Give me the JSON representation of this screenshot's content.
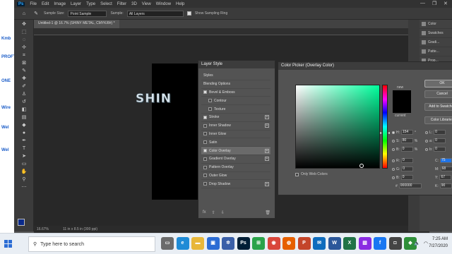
{
  "left_marks": [
    "Kmb",
    "PROFT",
    "ONE",
    "Wire",
    "Wel",
    "Wel"
  ],
  "menu": {
    "logo": "Ps",
    "items": [
      "File",
      "Edit",
      "Image",
      "Layer",
      "Type",
      "Select",
      "Filter",
      "3D",
      "View",
      "Window",
      "Help"
    ]
  },
  "options": {
    "sample_size_label": "Sample Size:",
    "sample_size_value": "Point Sample",
    "sample_label": "Sample:",
    "sample_value": "All Layers",
    "ring_label": "Show Sampling Ring"
  },
  "document": {
    "tab_title": "Untitled-1 @ 16.7% (SHINY METAL, CMYK/8#) *",
    "text": "SHIN",
    "zoom": "16.67%",
    "size": "11 in x 8.5 in (300 ppi)"
  },
  "right_panel": [
    "Color",
    "Swatches",
    "Gradi...",
    "Patte...",
    "Prop...",
    "Adju...",
    "Libr..."
  ],
  "layer_style": {
    "title": "Layer Style",
    "items": [
      {
        "label": "Styles",
        "check": null,
        "plus": false,
        "sub": false
      },
      {
        "label": "Blending Options",
        "check": null,
        "plus": false,
        "sub": false
      },
      {
        "label": "Bevel & Emboss",
        "check": true,
        "plus": false,
        "sub": false
      },
      {
        "label": "Contour",
        "check": false,
        "plus": false,
        "sub": true
      },
      {
        "label": "Texture",
        "check": false,
        "plus": false,
        "sub": true
      },
      {
        "label": "Stroke",
        "check": true,
        "plus": true,
        "sub": false
      },
      {
        "label": "Inner Shadow",
        "check": false,
        "plus": true,
        "sub": false
      },
      {
        "label": "Inner Glow",
        "check": false,
        "plus": false,
        "sub": false
      },
      {
        "label": "Satin",
        "check": false,
        "plus": false,
        "sub": false
      },
      {
        "label": "Color Overlay",
        "check": true,
        "plus": true,
        "sub": false
      },
      {
        "label": "Gradient Overlay",
        "check": false,
        "plus": true,
        "sub": false
      },
      {
        "label": "Pattern Overlay",
        "check": false,
        "plus": false,
        "sub": false
      },
      {
        "label": "Outer Glow",
        "check": false,
        "plus": false,
        "sub": false
      },
      {
        "label": "Drop Shadow",
        "check": false,
        "plus": true,
        "sub": false
      }
    ],
    "fx_label": "fx"
  },
  "color_picker": {
    "title": "Color Picker (Overlay Color)",
    "new_label": "new",
    "current_label": "current",
    "buttons": {
      "ok": "OK",
      "cancel": "Cancel",
      "swatches": "Add to Swatches",
      "libraries": "Color Libraries"
    },
    "only_web": "Only Web Colors",
    "hsb": [
      {
        "label": "H:",
        "value": "154",
        "unit": "°"
      },
      {
        "label": "S:",
        "value": "80",
        "unit": "%"
      },
      {
        "label": "B:",
        "value": "0",
        "unit": "%"
      }
    ],
    "rgb": [
      {
        "label": "R:",
        "value": "0"
      },
      {
        "label": "G:",
        "value": "0"
      },
      {
        "label": "B:",
        "value": "0"
      }
    ],
    "lab": [
      {
        "label": "L:",
        "value": "0"
      },
      {
        "label": "a:",
        "value": "0"
      },
      {
        "label": "b:",
        "value": "0"
      }
    ],
    "cmyk": [
      {
        "label": "C:",
        "value": "75",
        "unit": "%"
      },
      {
        "label": "M:",
        "value": "68",
        "unit": "%"
      },
      {
        "label": "Y:",
        "value": "67",
        "unit": "%"
      },
      {
        "label": "K:",
        "value": "90",
        "unit": "%"
      }
    ],
    "hex_label": "#",
    "hex": "000000",
    "selected_hex": "#000000"
  },
  "taskbar": {
    "search_placeholder": "Type here to search",
    "apps": [
      {
        "name": "task-view",
        "color": "#6b6b6b",
        "glyph": "▭"
      },
      {
        "name": "edge",
        "color": "#1e8bd6",
        "glyph": "e"
      },
      {
        "name": "file-explorer",
        "color": "#e8b73a",
        "glyph": "▬"
      },
      {
        "name": "store",
        "color": "#2b6cd4",
        "glyph": "▣"
      },
      {
        "name": "app-snow",
        "color": "#3a5fa8",
        "glyph": "✲"
      },
      {
        "name": "photoshop",
        "color": "#001e36",
        "glyph": "Ps"
      },
      {
        "name": "app-grid",
        "color": "#2aa34a",
        "glyph": "⊞"
      },
      {
        "name": "chrome",
        "color": "#d9463b",
        "glyph": "◉"
      },
      {
        "name": "firefox",
        "color": "#e66000",
        "glyph": "◍"
      },
      {
        "name": "powerpoint",
        "color": "#c4452a",
        "glyph": "P"
      },
      {
        "name": "mail",
        "color": "#0f6cbd",
        "glyph": "✉"
      },
      {
        "name": "word",
        "color": "#2b579a",
        "glyph": "W"
      },
      {
        "name": "excel",
        "color": "#217346",
        "glyph": "X"
      },
      {
        "name": "photos",
        "color": "#8a2be2",
        "glyph": "▧"
      },
      {
        "name": "facebook",
        "color": "#1877f2",
        "glyph": "f"
      },
      {
        "name": "camera",
        "color": "#444444",
        "glyph": "◘"
      },
      {
        "name": "app-green",
        "color": "#2f8f3a",
        "glyph": "◆"
      }
    ],
    "time": "7:25 AM",
    "date": "7/27/2020"
  }
}
